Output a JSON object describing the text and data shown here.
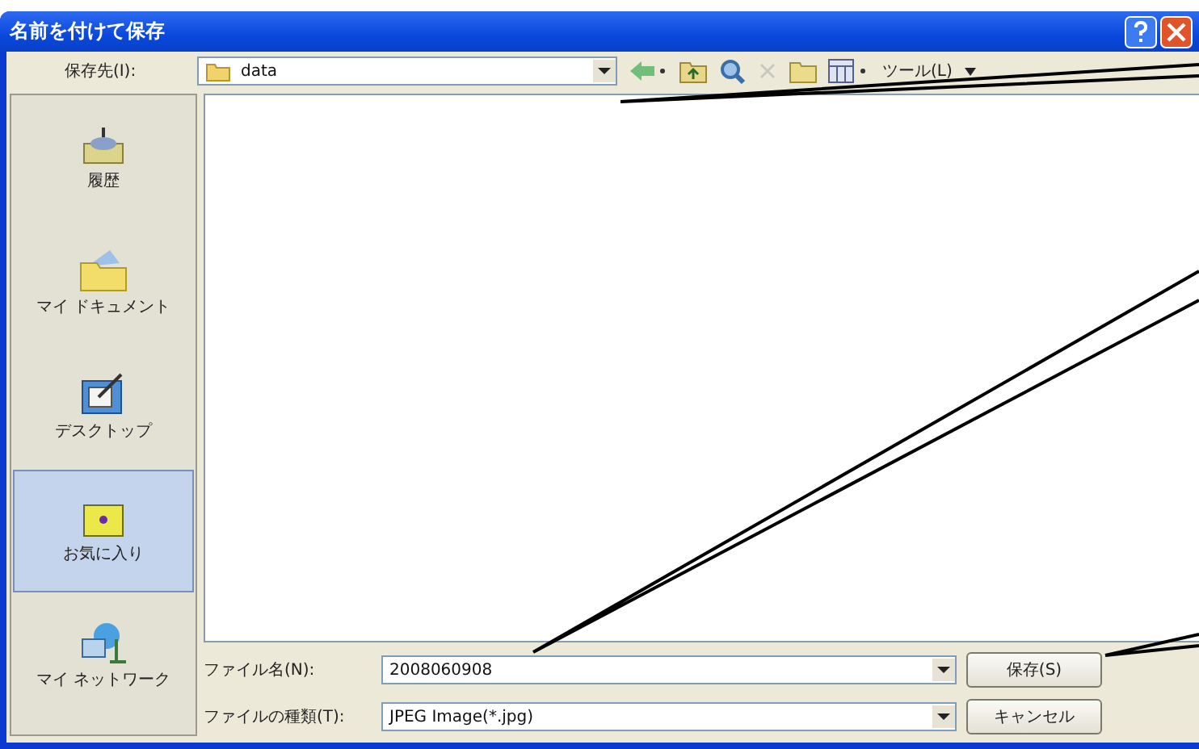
{
  "window": {
    "title": "名前を付けて保存"
  },
  "save_in": {
    "label": "保存先(I):",
    "value": "data"
  },
  "toolbar": {
    "tools_label": "ツール(L)"
  },
  "sidebar": {
    "items": [
      {
        "label": "履歴",
        "kind": "history",
        "selected": false
      },
      {
        "label": "マイ ドキュメント",
        "kind": "documents",
        "selected": false
      },
      {
        "label": "デスクトップ",
        "kind": "desktop",
        "selected": false
      },
      {
        "label": "お気に入り",
        "kind": "favorites",
        "selected": true
      },
      {
        "label": "マイ ネットワーク",
        "kind": "network",
        "selected": false
      }
    ]
  },
  "file_name": {
    "label": "ファイル名(N):",
    "value": "2008060908"
  },
  "file_type": {
    "label": "ファイルの種類(T):",
    "value": "JPEG Image(*.jpg)"
  },
  "buttons": [
    {
      "label": "保存(S)"
    },
    {
      "label": "キャンセル"
    }
  ]
}
